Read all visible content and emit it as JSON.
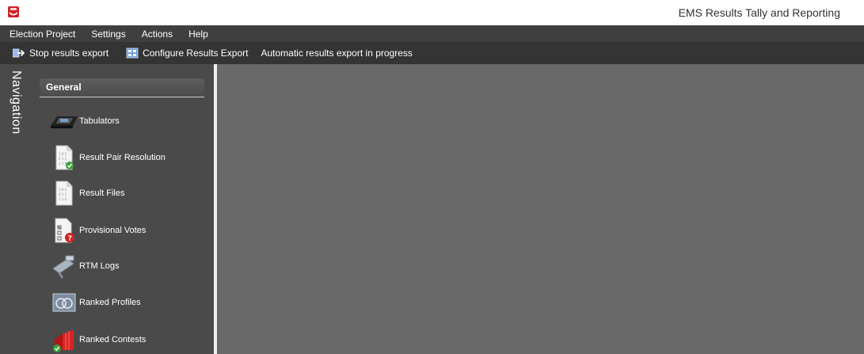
{
  "window": {
    "title": "EMS Results Tally and Reporting",
    "logo_icon": "rtm-logo-icon"
  },
  "menu": {
    "items": [
      {
        "label": "Election Project"
      },
      {
        "label": "Settings"
      },
      {
        "label": "Actions"
      },
      {
        "label": "Help"
      }
    ]
  },
  "toolbar": {
    "stop_export_label": "Stop results export",
    "configure_export_label": "Configure Results Export",
    "status_text": "Automatic results export in progress"
  },
  "navigation": {
    "rail_label": "Navigation",
    "group_title": "General",
    "items": [
      {
        "label": "Tabulators",
        "icon": "tabulator-icon"
      },
      {
        "label": "Result Pair Resolution",
        "icon": "result-pair-resolution-icon"
      },
      {
        "label": "Result Files",
        "icon": "result-files-icon"
      },
      {
        "label": "Provisional Votes",
        "icon": "provisional-votes-icon"
      },
      {
        "label": "RTM Logs",
        "icon": "rtm-logs-icon"
      },
      {
        "label": "Ranked Profiles",
        "icon": "ranked-profiles-icon"
      },
      {
        "label": "Ranked Contests",
        "icon": "ranked-contests-icon"
      }
    ]
  },
  "colors": {
    "menubar": "#3f3f3f",
    "toolbar": "#343434",
    "nav_panel": "#4a4a4a",
    "content": "#696969",
    "accent_red": "#c8102e"
  }
}
